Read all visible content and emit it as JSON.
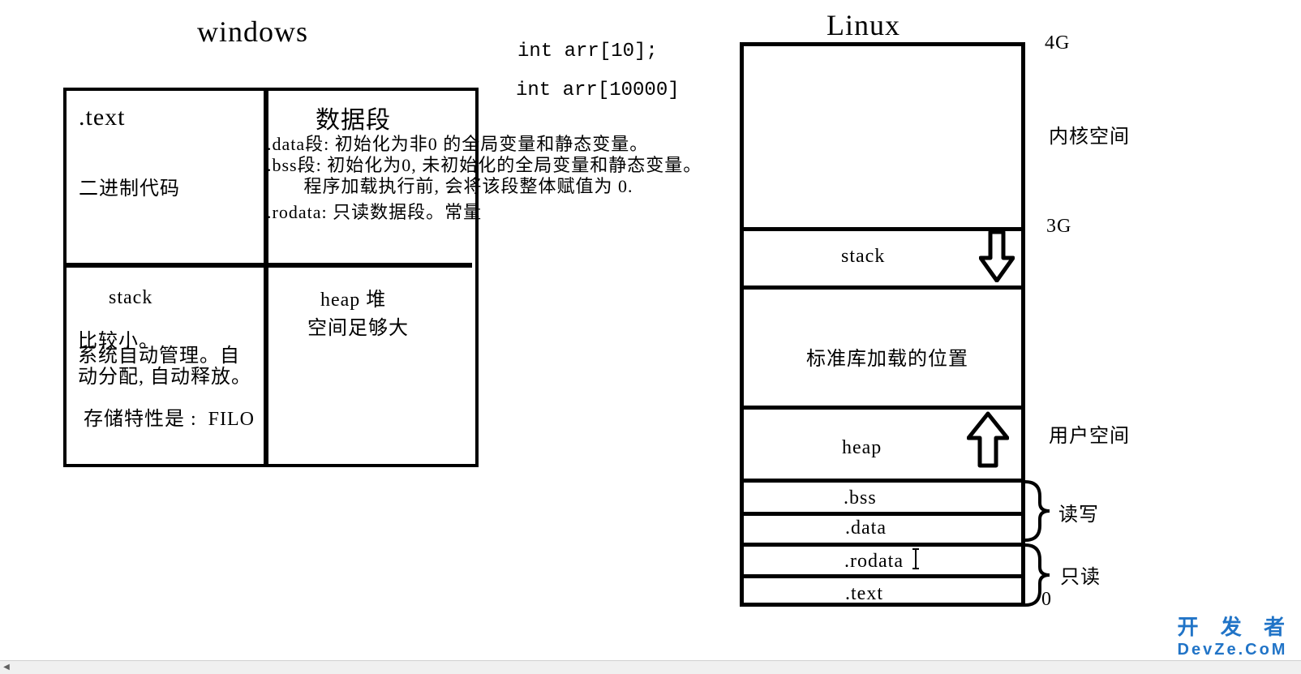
{
  "titles": {
    "windows": "windows",
    "linux": "Linux"
  },
  "code_snippets": {
    "arr_small": "int arr[10];",
    "arr_big": "int arr[10000]"
  },
  "windows_grid": {
    "text_title": ".text",
    "text_desc": "二进制代码",
    "dataseg_title": "数据段",
    "dataseg_line1": ".data段: 初始化为非0 的全局变量和静态变量。",
    "dataseg_line2": ".bss段: 初始化为0, 未初始化的全局变量和静态变量。",
    "dataseg_line3": "       程序加载执行前, 会将该段整体赋值为 0.",
    "dataseg_line4": ".rodata: 只读数据段。常量",
    "stack_title": "stack",
    "stack_desc1": "比较小。",
    "stack_desc2": "系统自动管理。自动分配, 自动释放。",
    "stack_desc3": "存储特性是 :  FILO",
    "heap_title": "heap 堆",
    "heap_desc": "空间足够大"
  },
  "linux_layout": {
    "addr_top": "4G",
    "addr_mid": "3G",
    "addr_bottom": "0",
    "kernel_label": "内核空间",
    "user_label": "用户空间",
    "stack": "stack",
    "lib": "标准库加载的位置",
    "heap": "heap",
    "bss": ".bss",
    "data": ".data",
    "rodata": ".rodata",
    "text": ".text",
    "rw_label": "读写",
    "ro_label": "只读"
  },
  "watermark": {
    "top": "开 发 者",
    "sub": "DevZe.CoM"
  }
}
